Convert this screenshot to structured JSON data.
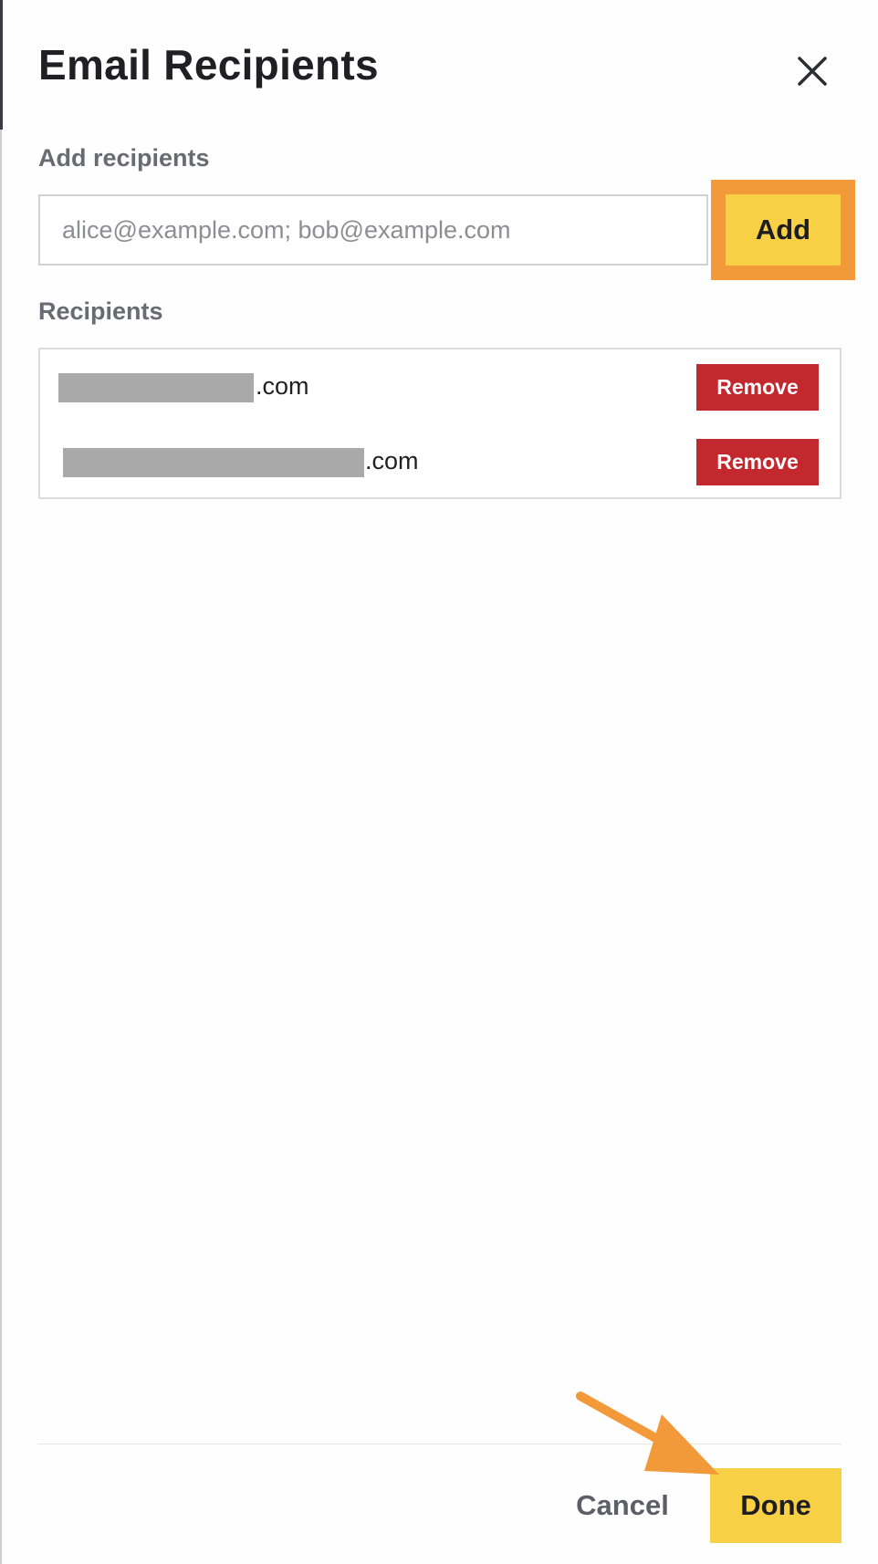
{
  "dialog": {
    "title": "Email Recipients",
    "close_icon": "close-icon"
  },
  "add_section": {
    "label": "Add recipients",
    "input_value": "",
    "input_placeholder": "alice@example.com; bob@example.com",
    "add_label": "Add"
  },
  "recipients_section": {
    "label": "Recipients",
    "items": [
      {
        "email_visible": ".com",
        "remove_label": "Remove"
      },
      {
        "email_visible": ".com",
        "remove_label": "Remove"
      }
    ]
  },
  "footer": {
    "cancel_label": "Cancel",
    "done_label": "Done"
  },
  "colors": {
    "accent_yellow": "#f8d046",
    "highlight_orange": "#f2993a",
    "remove_red": "#c3282e",
    "redaction_gray": "#a9a9a9"
  }
}
